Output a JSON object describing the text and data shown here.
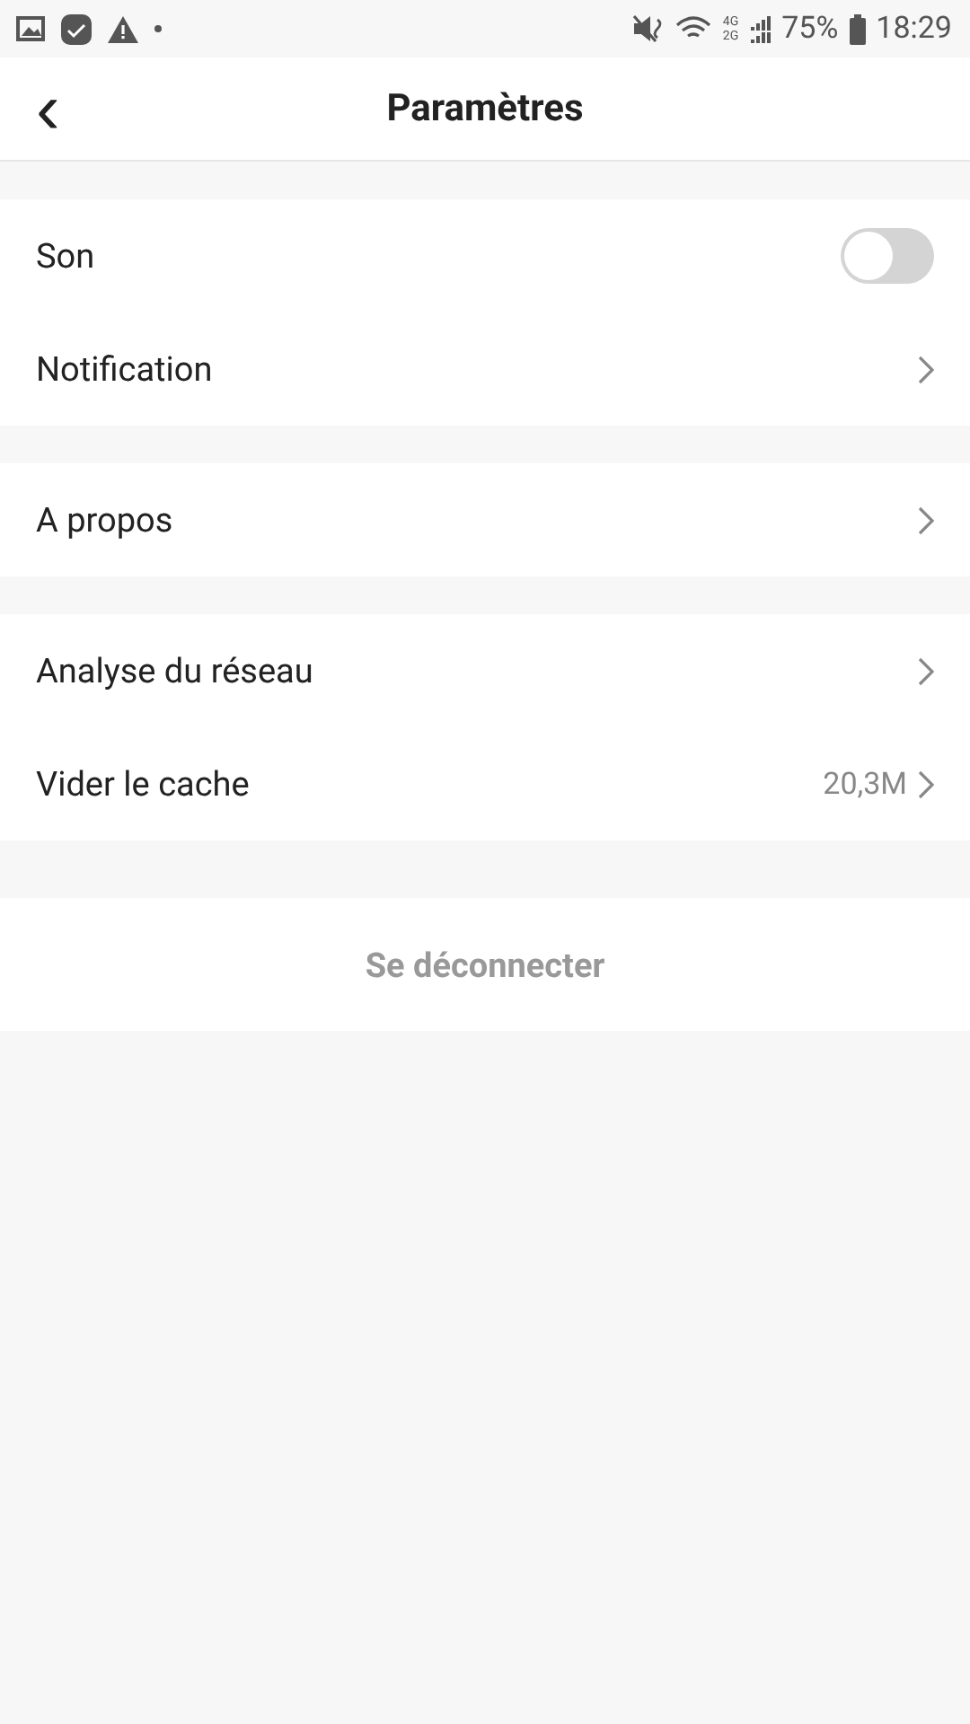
{
  "status_bar": {
    "network_top": "4G",
    "network_bottom": "2G",
    "battery": "75%",
    "time": "18:29"
  },
  "header": {
    "back": "‹",
    "title": "Paramètres"
  },
  "sections": [
    {
      "items": [
        {
          "kind": "toggle",
          "label": "Son",
          "on": false
        },
        {
          "kind": "link",
          "label": "Notification"
        }
      ]
    },
    {
      "items": [
        {
          "kind": "link",
          "label": "A propos"
        }
      ]
    },
    {
      "items": [
        {
          "kind": "link",
          "label": "Analyse du réseau"
        },
        {
          "kind": "link",
          "label": "Vider le cache",
          "value": "20,3M"
        }
      ]
    }
  ],
  "logout": "Se déconnecter"
}
